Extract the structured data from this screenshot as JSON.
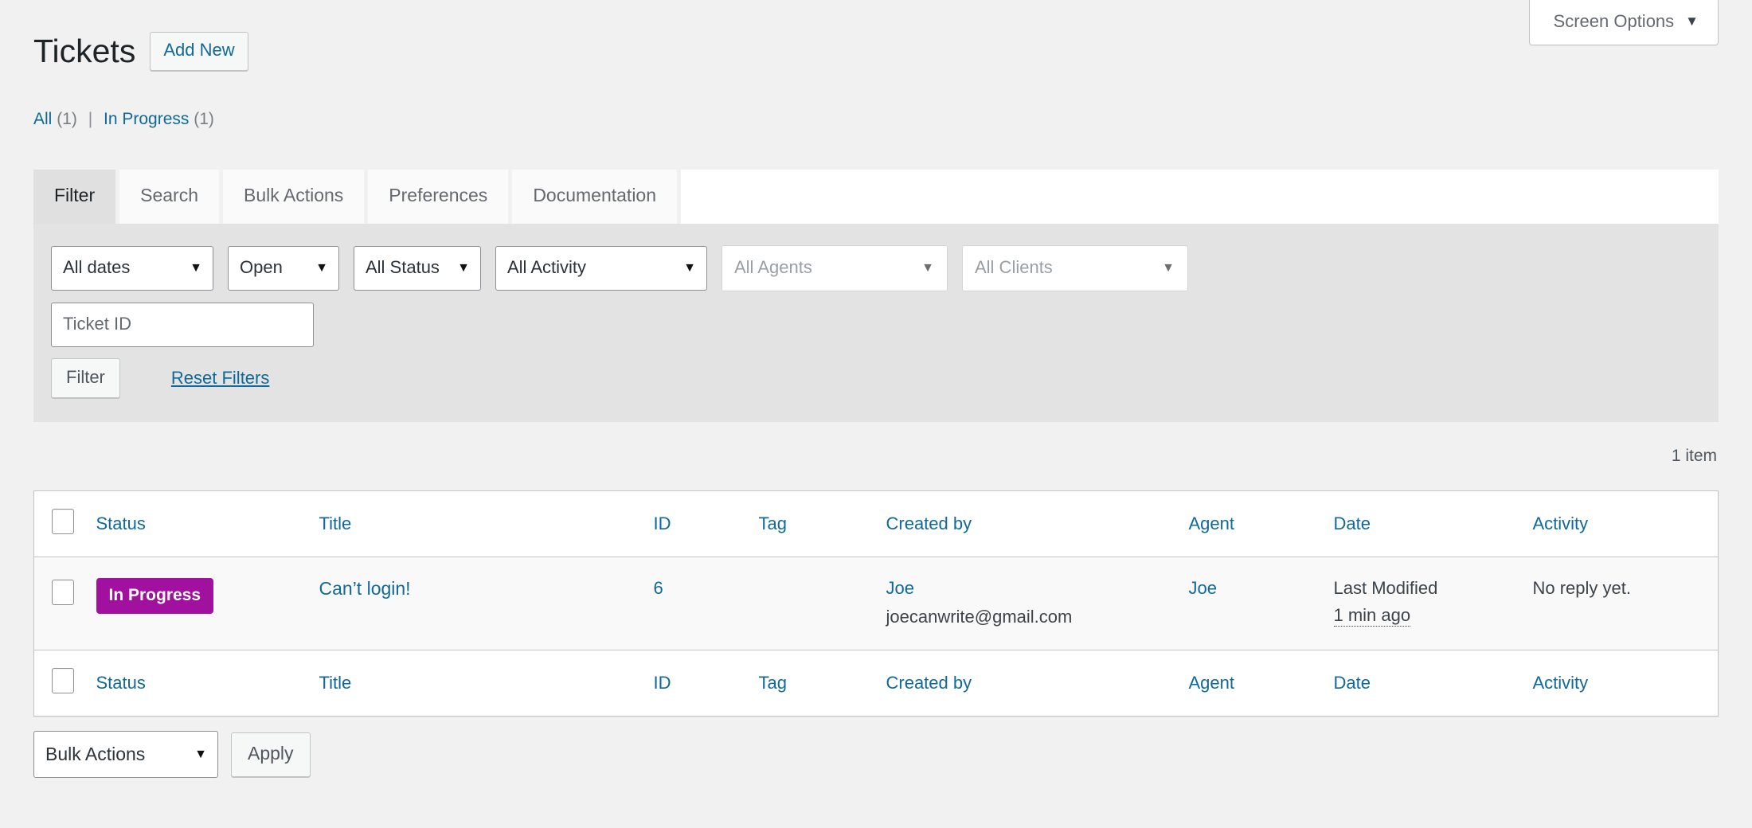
{
  "screen_meta": {
    "screen_options_label": "Screen Options",
    "caret_icon": "chevron-down-icon",
    "caret_glyph": "▼"
  },
  "header": {
    "page_title": "Tickets",
    "add_new_label": "Add New"
  },
  "status_links": [
    {
      "label": "All",
      "count": "(1)"
    },
    {
      "label": "In Progress",
      "count": "(1)"
    }
  ],
  "status_links_separator": "|",
  "tabs": [
    {
      "label": "Filter",
      "active": true
    },
    {
      "label": "Search",
      "active": false
    },
    {
      "label": "Bulk Actions",
      "active": false
    },
    {
      "label": "Preferences",
      "active": false
    },
    {
      "label": "Documentation",
      "active": false
    }
  ],
  "filters": {
    "dates": {
      "value": "All dates",
      "caret": "▼"
    },
    "open": {
      "value": "Open",
      "caret": "▼"
    },
    "status": {
      "value": "All Status",
      "caret": "▼"
    },
    "activity": {
      "value": "All Activity",
      "caret": "▼"
    },
    "agents": {
      "value": "All Agents",
      "caret": "▼"
    },
    "clients": {
      "value": "All Clients",
      "caret": "▼"
    },
    "ticket_id_placeholder": "Ticket ID",
    "ticket_id_value": "",
    "filter_button": "Filter",
    "reset_link": "Reset Filters"
  },
  "tablenav": {
    "displaying_num": "1 item",
    "bulk_actions_value": "Bulk Actions",
    "bulk_caret": "▼",
    "apply_label": "Apply"
  },
  "table": {
    "columns": [
      "Status",
      "Title",
      "ID",
      "Tag",
      "Created by",
      "Agent",
      "Date",
      "Activity"
    ],
    "rows": [
      {
        "status": "In Progress",
        "status_color": "#a1109f",
        "title": "Can’t login!",
        "id": "6",
        "tag": "",
        "created_by_name": "Joe",
        "created_by_email": "joecanwrite@gmail.com",
        "agent": "Joe",
        "date_label": "Last Modified",
        "date_relative": "1 min ago",
        "activity": "No reply yet."
      }
    ]
  },
  "theme": {
    "link_color": "#0f6999",
    "page_bg": "#f1f1f1",
    "filter_panel_bg": "#e3e3e3",
    "active_tab_bg": "#e0e0e0",
    "badge_bg": "#a1109f"
  }
}
